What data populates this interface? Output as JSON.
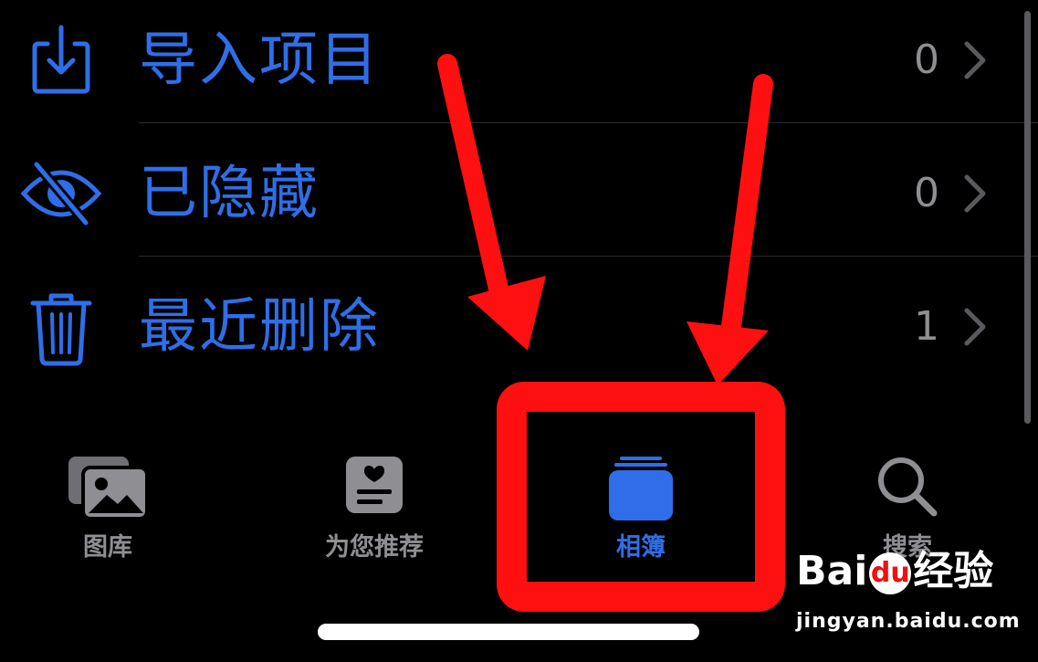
{
  "list": {
    "items": [
      {
        "label": "导入项目",
        "count": "0",
        "icon": "import-icon"
      },
      {
        "label": "已隐藏",
        "count": "0",
        "icon": "eye-slash-icon"
      },
      {
        "label": "最近删除",
        "count": "1",
        "icon": "trash-icon"
      }
    ]
  },
  "tabbar": {
    "tabs": [
      {
        "label": "图库",
        "icon": "photos-icon",
        "active": false
      },
      {
        "label": "为您推荐",
        "icon": "for-you-icon",
        "active": false
      },
      {
        "label": "相簿",
        "icon": "albums-icon",
        "active": true
      },
      {
        "label": "搜索",
        "icon": "search-icon",
        "active": false
      }
    ]
  },
  "watermark": {
    "logo_left": "Bai",
    "logo_paw": "du",
    "logo_right": "经验",
    "url": "jingyan.baidu.com"
  },
  "colors": {
    "accent": "#2f6ee8",
    "secondary_text": "#8e8e93",
    "annotation_red": "#ff1010",
    "background": "#000000"
  }
}
